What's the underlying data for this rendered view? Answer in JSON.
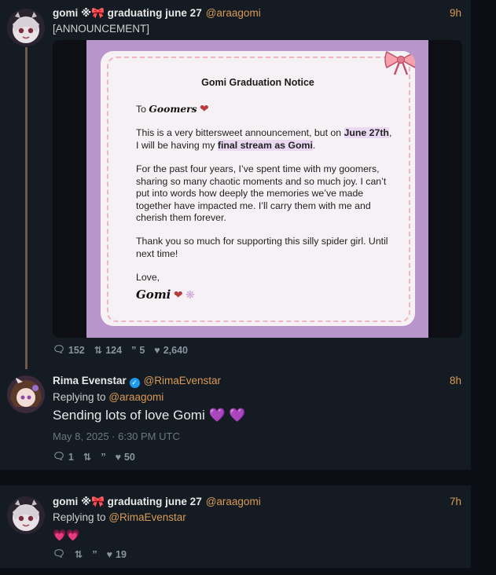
{
  "post1": {
    "name": "gomi ※🎀 graduating june 27",
    "handle": "@araagomi",
    "time": "9h",
    "text": "[ANNOUNCEMENT]",
    "notice": {
      "title": "Gomi Graduation Notice",
      "to_label": "To",
      "to_name": "Goomers",
      "p1_a": "This is a very bittersweet announcement, but on",
      "p1_date": "June 27th",
      "p1_b": ", I will be having my ",
      "p1_hl": "final stream as Gomi",
      "p1_c": ".",
      "p2": "For the past four years, I’ve spent time with my goomers, sharing so many chaotic moments and so much joy. I can’t put into words how deeply the memories we’ve made together have impacted me. I’ll carry them with me and cherish them forever.",
      "p3": "Thank you so much for supporting this silly spider girl. Until next time!",
      "love": "Love,",
      "signature": "Gomi"
    },
    "stats": {
      "replies": "152",
      "reposts": "124",
      "quotes": "5",
      "likes": "2,640"
    }
  },
  "post2": {
    "name": "Rima Evenstar",
    "handle": "@RimaEvenstar",
    "time": "8h",
    "replying_label": "Replying to",
    "replying_to": "@araagomi",
    "text": "Sending lots of love Gomi 💜 💜",
    "date": "May 8, 2025 · 6:30 PM UTC",
    "stats": {
      "replies": "1",
      "likes": "50"
    }
  },
  "post3": {
    "name": "gomi ※🎀 graduating june 27",
    "handle": "@araagomi",
    "time": "7h",
    "replying_label": "Replying to",
    "replying_to": "@RimaEvenstar",
    "text": "💗💗",
    "stats": {
      "likes": "19"
    }
  },
  "colors": {
    "accent": "#d99a55",
    "panel": "#141b23",
    "background": "#0b0e14",
    "notice_bg": "#b896cc"
  }
}
